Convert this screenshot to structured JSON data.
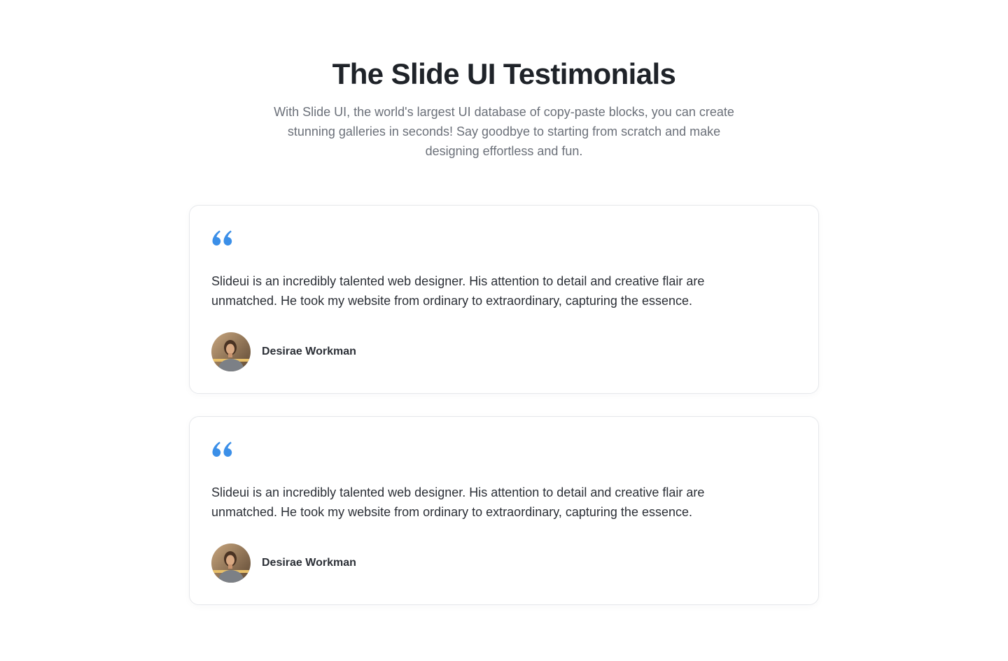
{
  "header": {
    "title": "The Slide UI Testimonials",
    "subtitle": "With Slide UI, the world's largest UI database of copy-paste blocks, you can create stunning galleries in seconds! Say goodbye to starting from scratch and make designing effortless and fun."
  },
  "colors": {
    "accent": "#3b8fe8",
    "title": "#1f2329",
    "subtitle": "#6b7079",
    "card_border": "#e6e8eb"
  },
  "testimonials": [
    {
      "quote_icon": "quote-icon",
      "text": "Slideui is an incredibly talented web designer. His attention to detail and creative flair are unmatched. He took my website from ordinary to extraordinary, capturing the essence.",
      "author": "Desirae Workman",
      "avatar": "avatar-photo"
    },
    {
      "quote_icon": "quote-icon",
      "text": "Slideui is an incredibly talented web designer. His attention to detail and creative flair are unmatched. He took my website from ordinary to extraordinary, capturing the essence.",
      "author": "Desirae Workman",
      "avatar": "avatar-photo"
    }
  ]
}
